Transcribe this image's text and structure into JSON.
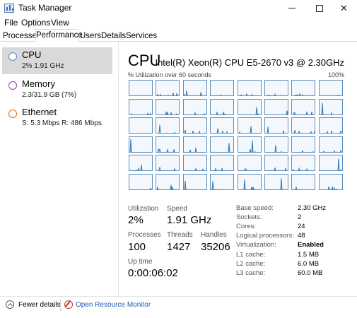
{
  "window": {
    "title": "Task Manager"
  },
  "menu": [
    "File",
    "Options",
    "View"
  ],
  "tabs": [
    "Processes",
    "Performance",
    "Users",
    "Details",
    "Services"
  ],
  "active_tab": "Performance",
  "sidebar": [
    {
      "title": "CPU",
      "sub": "2%  1.91 GHz",
      "color": "#4c8ad9"
    },
    {
      "title": "Memory",
      "sub": "2.3/31.9 GB (7%)",
      "color": "#a23bb5"
    },
    {
      "title": "Ethernet",
      "sub": "S: 5.3 Mbps  R: 486 Mbps",
      "color": "#d06c2a"
    }
  ],
  "cpu": {
    "title": "CPU",
    "model": "Intel(R) Xeon(R) CPU E5-2670 v3 @ 2.30GHz",
    "util_label": "% Utilization over 60 seconds",
    "util_max": "100%",
    "logical_graphs": 48,
    "graph_color": "#2a7ab8",
    "stats": {
      "utilization_label": "Utilization",
      "utilization": "2%",
      "speed_label": "Speed",
      "speed": "1.91 GHz",
      "processes_label": "Processes",
      "processes": "100",
      "threads_label": "Threads",
      "threads": "1427",
      "handles_label": "Handles",
      "handles": "35206",
      "uptime_label": "Up time",
      "uptime": "0:00:06:02"
    },
    "specs": [
      {
        "label": "Base speed:",
        "value": "2.30 GHz"
      },
      {
        "label": "Sockets:",
        "value": "2"
      },
      {
        "label": "Cores:",
        "value": "24"
      },
      {
        "label": "Logical processors:",
        "value": "48"
      },
      {
        "label": "Virtualization:",
        "value": "Enabled"
      },
      {
        "label": "L1 cache:",
        "value": "1.5 MB"
      },
      {
        "label": "L2 cache:",
        "value": "6.0 MB"
      },
      {
        "label": "L3 cache:",
        "value": "60.0 MB"
      }
    ]
  },
  "footer": {
    "fewer_details": "Fewer details",
    "resource_monitor": "Open Resource Monitor"
  }
}
